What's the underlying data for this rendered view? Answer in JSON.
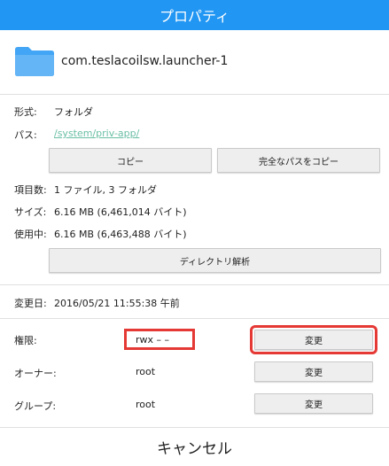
{
  "dialog": {
    "title": "プロパティ",
    "cancel_label": "キャンセル"
  },
  "file": {
    "name": "com.teslacoilsw.launcher-1",
    "icon": "folder-icon"
  },
  "info": {
    "format_label": "形式:",
    "format_value": "フォルダ",
    "path_label": "パス:",
    "path_value": "/system/priv-app/",
    "copy_button": "コピー",
    "copy_full_path_button": "完全なパスをコピー",
    "items_label": "項目数:",
    "items_value": "1 ファイル, 3 フォルダ",
    "size_label": "サイズ:",
    "size_value": "6.16 MB (6,461,014 バイト)",
    "used_label": "使用中:",
    "used_value": "6.16 MB (6,463,488 バイト)",
    "analyze_button": "ディレクトリ解析",
    "modified_label": "変更日:",
    "modified_value": "2016/05/21 11:55:38 午前"
  },
  "permissions": {
    "perm_label": "権限:",
    "perm_value": "rwx – –",
    "perm_change": "変更",
    "owner_label": "オーナー:",
    "owner_value": "root",
    "owner_change": "変更",
    "group_label": "グループ:",
    "group_value": "root",
    "group_change": "変更"
  },
  "colors": {
    "title_bar": "#2196f3",
    "highlight": "#e53935",
    "link": "#6abfa5",
    "folder": "#42a5f5"
  }
}
